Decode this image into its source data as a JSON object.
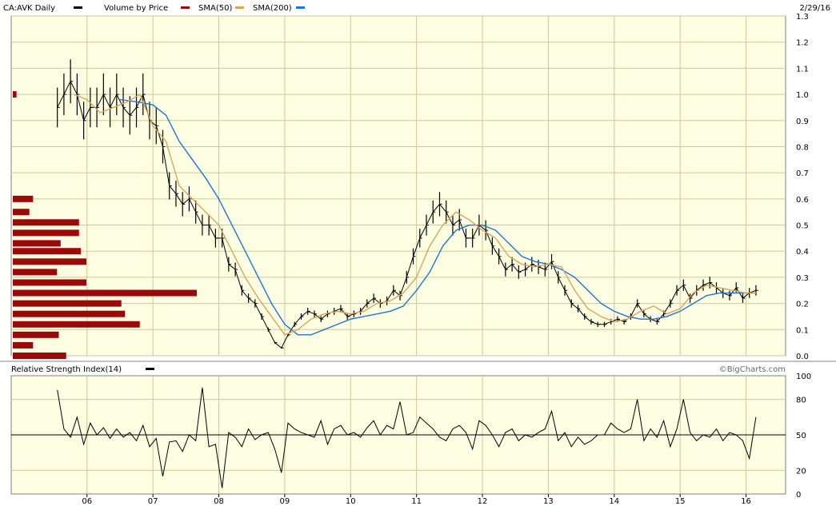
{
  "header": {
    "symbol_label": "CA:AVK Daily",
    "legend": [
      {
        "label": "Volume by Price",
        "color": "#9b0a0a"
      },
      {
        "label": "SMA(50)",
        "color": "#d8a55a"
      },
      {
        "label": "SMA(200)",
        "color": "#1f74d6"
      }
    ],
    "date": "2/29/16",
    "price_legend_color": "#000000"
  },
  "rsi_header": {
    "label": "Relative Strength Index(14)",
    "color": "#000000",
    "watermark": "©BigCharts.com"
  },
  "colors": {
    "plot_bg": "#fdfde2",
    "grid": "#c9c99a",
    "price": "#000000",
    "sma50": "#d8a55a",
    "sma200": "#1f74d6",
    "vbp": "#9b0a0a",
    "rsi": "#000000"
  },
  "chart_data": [
    {
      "type": "line",
      "name": "price",
      "title": "CA:AVK Daily",
      "x_ticks": [
        "06",
        "07",
        "08",
        "09",
        "10",
        "11",
        "12",
        "13",
        "14",
        "15",
        "16"
      ],
      "x_tick_positions": [
        2006.0,
        2007.0,
        2008.0,
        2009.0,
        2010.0,
        2011.0,
        2012.0,
        2013.0,
        2014.0,
        2015.0,
        2016.0
      ],
      "xlim": [
        2004.85,
        2016.6
      ],
      "ylim": [
        0.0,
        1.3
      ],
      "y_ticks": [
        0.0,
        0.1,
        0.2,
        0.3,
        0.4,
        0.5,
        0.6,
        0.7,
        0.8,
        0.9,
        1.0,
        1.1,
        1.2,
        1.3
      ],
      "grid": true,
      "series": [
        {
          "name": "Price",
          "x": [
            2005.55,
            2005.65,
            2005.75,
            2005.85,
            2005.95,
            2006.05,
            2006.15,
            2006.25,
            2006.35,
            2006.45,
            2006.55,
            2006.65,
            2006.75,
            2006.85,
            2006.95,
            2007.05,
            2007.15,
            2007.25,
            2007.35,
            2007.45,
            2007.55,
            2007.65,
            2007.75,
            2007.85,
            2007.95,
            2008.05,
            2008.15,
            2008.25,
            2008.35,
            2008.45,
            2008.55,
            2008.65,
            2008.75,
            2008.85,
            2008.95,
            2009.05,
            2009.15,
            2009.25,
            2009.35,
            2009.45,
            2009.55,
            2009.65,
            2009.75,
            2009.85,
            2009.95,
            2010.05,
            2010.15,
            2010.25,
            2010.35,
            2010.45,
            2010.55,
            2010.65,
            2010.75,
            2010.85,
            2010.95,
            2011.05,
            2011.15,
            2011.25,
            2011.35,
            2011.45,
            2011.55,
            2011.65,
            2011.75,
            2011.85,
            2011.95,
            2012.05,
            2012.15,
            2012.25,
            2012.35,
            2012.45,
            2012.55,
            2012.65,
            2012.75,
            2012.85,
            2012.95,
            2013.05,
            2013.15,
            2013.25,
            2013.35,
            2013.45,
            2013.55,
            2013.65,
            2013.75,
            2013.85,
            2013.95,
            2014.05,
            2014.15,
            2014.25,
            2014.35,
            2014.45,
            2014.55,
            2014.65,
            2014.75,
            2014.85,
            2014.95,
            2015.05,
            2015.15,
            2015.25,
            2015.35,
            2015.45,
            2015.55,
            2015.65,
            2015.75,
            2015.85,
            2015.95,
            2016.05,
            2016.15
          ],
          "values": [
            0.95,
            1.0,
            1.05,
            1.0,
            0.9,
            0.95,
            0.95,
            1.0,
            0.95,
            1.0,
            0.95,
            0.92,
            0.95,
            1.0,
            0.9,
            0.88,
            0.8,
            0.65,
            0.62,
            0.58,
            0.6,
            0.55,
            0.5,
            0.5,
            0.45,
            0.45,
            0.35,
            0.33,
            0.25,
            0.22,
            0.2,
            0.15,
            0.1,
            0.05,
            0.03,
            0.08,
            0.12,
            0.15,
            0.17,
            0.16,
            0.14,
            0.16,
            0.17,
            0.18,
            0.15,
            0.16,
            0.17,
            0.2,
            0.22,
            0.2,
            0.21,
            0.25,
            0.23,
            0.3,
            0.38,
            0.45,
            0.5,
            0.55,
            0.58,
            0.55,
            0.5,
            0.52,
            0.45,
            0.45,
            0.5,
            0.48,
            0.42,
            0.38,
            0.33,
            0.35,
            0.32,
            0.33,
            0.35,
            0.34,
            0.33,
            0.36,
            0.3,
            0.25,
            0.2,
            0.18,
            0.15,
            0.13,
            0.12,
            0.12,
            0.13,
            0.14,
            0.13,
            0.15,
            0.2,
            0.16,
            0.14,
            0.13,
            0.16,
            0.2,
            0.25,
            0.27,
            0.22,
            0.25,
            0.27,
            0.28,
            0.26,
            0.24,
            0.23,
            0.26,
            0.22,
            0.24,
            0.25
          ]
        },
        {
          "name": "SMA(50)",
          "x": [
            2005.8,
            2006.0,
            2006.2,
            2006.4,
            2006.6,
            2006.8,
            2007.0,
            2007.2,
            2007.4,
            2007.6,
            2007.8,
            2008.0,
            2008.2,
            2008.4,
            2008.6,
            2008.8,
            2009.0,
            2009.2,
            2009.4,
            2009.6,
            2009.8,
            2010.0,
            2010.2,
            2010.4,
            2010.6,
            2010.8,
            2011.0,
            2011.2,
            2011.4,
            2011.6,
            2011.8,
            2012.0,
            2012.2,
            2012.4,
            2012.6,
            2012.8,
            2013.0,
            2013.2,
            2013.4,
            2013.6,
            2013.8,
            2014.0,
            2014.2,
            2014.4,
            2014.6,
            2014.8,
            2015.0,
            2015.2,
            2015.4,
            2015.6,
            2015.8,
            2016.0,
            2016.15
          ],
          "values": [
            1.0,
            0.98,
            0.93,
            0.95,
            0.97,
            1.0,
            0.88,
            0.82,
            0.65,
            0.6,
            0.55,
            0.5,
            0.4,
            0.3,
            0.22,
            0.15,
            0.08,
            0.1,
            0.14,
            0.16,
            0.17,
            0.16,
            0.17,
            0.2,
            0.21,
            0.24,
            0.3,
            0.42,
            0.5,
            0.55,
            0.52,
            0.48,
            0.45,
            0.38,
            0.35,
            0.34,
            0.35,
            0.34,
            0.25,
            0.18,
            0.15,
            0.13,
            0.14,
            0.17,
            0.19,
            0.16,
            0.18,
            0.24,
            0.27,
            0.26,
            0.25,
            0.24,
            0.24
          ]
        },
        {
          "name": "SMA(200)",
          "x": [
            2006.5,
            2006.8,
            2007.0,
            2007.2,
            2007.4,
            2007.6,
            2007.8,
            2008.0,
            2008.2,
            2008.4,
            2008.6,
            2008.8,
            2009.0,
            2009.2,
            2009.4,
            2009.6,
            2009.8,
            2010.0,
            2010.2,
            2010.4,
            2010.6,
            2010.8,
            2011.0,
            2011.2,
            2011.4,
            2011.6,
            2011.8,
            2012.0,
            2012.2,
            2012.4,
            2012.6,
            2012.8,
            2013.0,
            2013.2,
            2013.4,
            2013.6,
            2013.8,
            2014.0,
            2014.2,
            2014.4,
            2014.6,
            2014.8,
            2015.0,
            2015.2,
            2015.4,
            2015.6,
            2015.8,
            2016.0,
            2016.15
          ],
          "values": [
            0.98,
            0.97,
            0.96,
            0.92,
            0.82,
            0.75,
            0.68,
            0.6,
            0.5,
            0.4,
            0.3,
            0.2,
            0.12,
            0.08,
            0.08,
            0.1,
            0.12,
            0.14,
            0.15,
            0.16,
            0.17,
            0.19,
            0.25,
            0.32,
            0.42,
            0.48,
            0.5,
            0.5,
            0.48,
            0.43,
            0.38,
            0.36,
            0.35,
            0.33,
            0.3,
            0.25,
            0.2,
            0.17,
            0.15,
            0.14,
            0.14,
            0.15,
            0.17,
            0.2,
            0.23,
            0.24,
            0.24,
            0.24,
            0.24
          ]
        }
      ],
      "volume_by_price": {
        "price_levels": [
          1.0,
          0.6,
          0.55,
          0.51,
          0.47,
          0.43,
          0.4,
          0.36,
          0.32,
          0.28,
          0.24,
          0.2,
          0.16,
          0.12,
          0.08,
          0.04
        ],
        "relative_volume": [
          0.02,
          0.11,
          0.09,
          0.36,
          0.36,
          0.26,
          0.37,
          0.4,
          0.24,
          0.4,
          1.0,
          0.59,
          0.61,
          0.69,
          0.25,
          0.11,
          0.29
        ]
      }
    },
    {
      "type": "line",
      "name": "rsi",
      "title": "Relative Strength Index(14)",
      "ylim": [
        0,
        100
      ],
      "y_ticks": [
        0,
        20,
        50,
        80,
        100
      ],
      "reference_line": 50,
      "xlim": [
        2004.85,
        2016.6
      ],
      "series": [
        {
          "name": "RSI(14)",
          "x": [
            2005.55,
            2005.65,
            2005.75,
            2005.85,
            2005.95,
            2006.05,
            2006.15,
            2006.25,
            2006.35,
            2006.45,
            2006.55,
            2006.65,
            2006.75,
            2006.85,
            2006.95,
            2007.05,
            2007.15,
            2007.25,
            2007.35,
            2007.45,
            2007.55,
            2007.65,
            2007.75,
            2007.85,
            2007.95,
            2008.05,
            2008.15,
            2008.25,
            2008.35,
            2008.45,
            2008.55,
            2008.65,
            2008.75,
            2008.85,
            2008.95,
            2009.05,
            2009.15,
            2009.25,
            2009.35,
            2009.45,
            2009.55,
            2009.65,
            2009.75,
            2009.85,
            2009.95,
            2010.05,
            2010.15,
            2010.25,
            2010.35,
            2010.45,
            2010.55,
            2010.65,
            2010.75,
            2010.85,
            2010.95,
            2011.05,
            2011.15,
            2011.25,
            2011.35,
            2011.45,
            2011.55,
            2011.65,
            2011.75,
            2011.85,
            2011.95,
            2012.05,
            2012.15,
            2012.25,
            2012.35,
            2012.45,
            2012.55,
            2012.65,
            2012.75,
            2012.85,
            2012.95,
            2013.05,
            2013.15,
            2013.25,
            2013.35,
            2013.45,
            2013.55,
            2013.65,
            2013.75,
            2013.85,
            2013.95,
            2014.05,
            2014.15,
            2014.25,
            2014.35,
            2014.45,
            2014.55,
            2014.65,
            2014.75,
            2014.85,
            2014.95,
            2015.05,
            2015.15,
            2015.25,
            2015.35,
            2015.45,
            2015.55,
            2015.65,
            2015.75,
            2015.85,
            2015.95,
            2016.05,
            2016.15
          ],
          "values": [
            88,
            55,
            48,
            65,
            42,
            60,
            50,
            56,
            47,
            55,
            48,
            52,
            45,
            58,
            40,
            47,
            15,
            44,
            45,
            36,
            50,
            45,
            90,
            40,
            42,
            5,
            52,
            48,
            40,
            55,
            46,
            50,
            52,
            38,
            18,
            60,
            55,
            52,
            50,
            48,
            62,
            42,
            55,
            58,
            50,
            52,
            48,
            56,
            62,
            50,
            58,
            55,
            78,
            50,
            52,
            65,
            60,
            55,
            48,
            45,
            55,
            58,
            52,
            38,
            62,
            58,
            50,
            40,
            52,
            55,
            45,
            50,
            48,
            52,
            55,
            70,
            45,
            52,
            40,
            48,
            42,
            45,
            50,
            50,
            60,
            55,
            52,
            55,
            80,
            45,
            55,
            48,
            62,
            40,
            55,
            80,
            52,
            45,
            50,
            48,
            55,
            45,
            52,
            50,
            45,
            30,
            65
          ]
        }
      ]
    }
  ]
}
